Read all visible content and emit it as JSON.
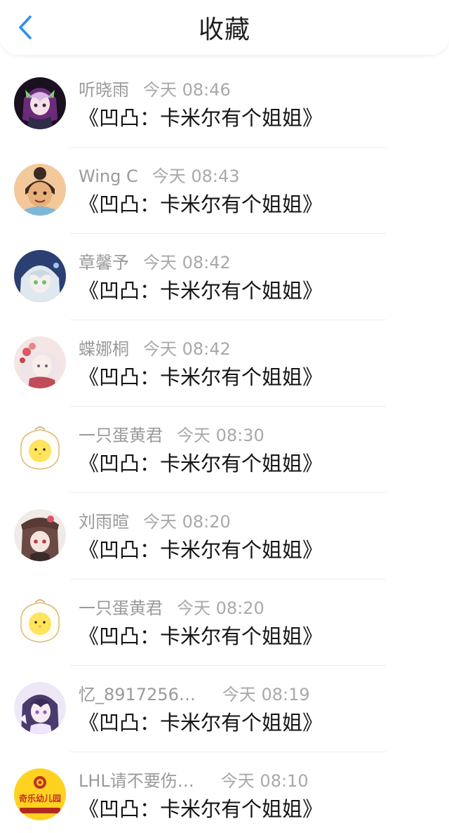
{
  "header": {
    "title": "收藏",
    "back_icon": "chevron-left-icon",
    "accent_color": "#2f8ff0"
  },
  "items": [
    {
      "username": "听晓雨",
      "time": "今天 08:46",
      "message": "《凹凸：卡米尔有个姐姐》",
      "avatar": "anime-girl-green-hair"
    },
    {
      "username": "Wing C",
      "time": "今天 08:43",
      "message": "《凹凸：卡米尔有个姐姐》",
      "avatar": "cartoon-girl-bun"
    },
    {
      "username": "章馨予",
      "time": "今天 08:42",
      "message": "《凹凸：卡米尔有个姐姐》",
      "avatar": "anime-girl-white-hair"
    },
    {
      "username": "蝶娜桐",
      "time": "今天 08:42",
      "message": "《凹凸：卡米尔有个姐姐》",
      "avatar": "anime-girl-flowers"
    },
    {
      "username": "一只蛋黄君",
      "time": "今天 08:30",
      "message": "《凹凸：卡米尔有个姐姐》",
      "avatar": "egg-yolk-chick"
    },
    {
      "username": "刘雨暄",
      "time": "今天 08:20",
      "message": "《凹凸：卡米尔有个姐姐》",
      "avatar": "anime-girl-hat"
    },
    {
      "username": "一只蛋黄君",
      "time": "今天 08:20",
      "message": "《凹凸：卡米尔有个姐姐》",
      "avatar": "egg-yolk-chick"
    },
    {
      "username": "忆_8917256…",
      "time": "今天 08:19",
      "message": "《凹凸：卡米尔有个姐姐》",
      "avatar": "anime-girl-purple-hair"
    },
    {
      "username": "LHL请不要伤…",
      "time": "今天 08:10",
      "message": "《凹凸：卡米尔有个姐姐》",
      "avatar": "kindergarten-logo",
      "avatar_text": "奇乐幼儿园"
    }
  ]
}
